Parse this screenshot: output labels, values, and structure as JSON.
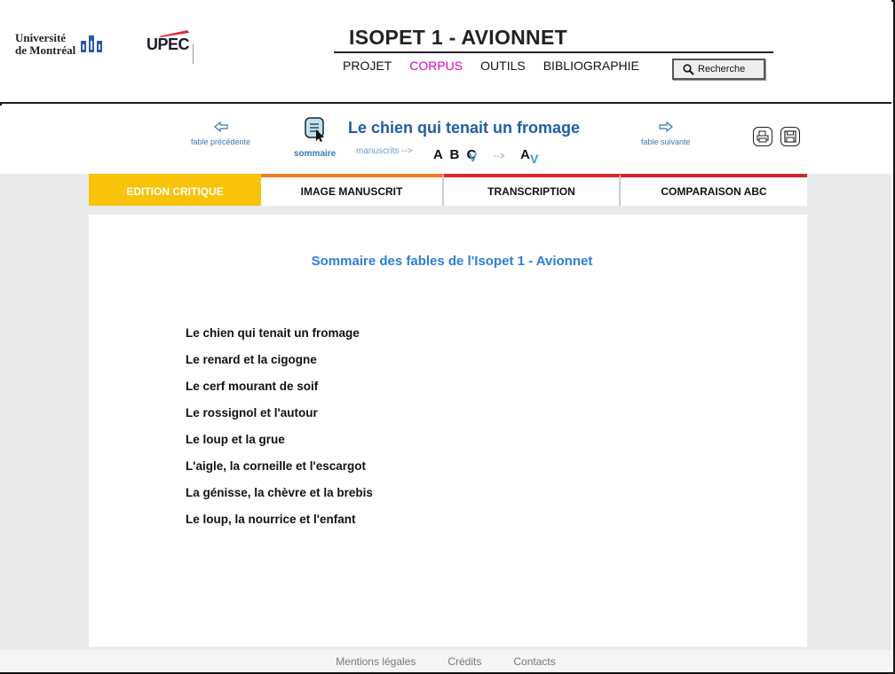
{
  "header": {
    "udem": {
      "line1": "Université",
      "line2": "de Montréal"
    },
    "upec": {
      "name": "UPEC"
    },
    "site_title": "ISOPET 1 - AVIONNET",
    "nav": [
      {
        "label": "PROJET"
      },
      {
        "label": "CORPUS",
        "active": true
      },
      {
        "label": "OUTILS"
      },
      {
        "label": "BIBLIOGRAPHIE"
      }
    ],
    "search_label": "Recherche"
  },
  "fable_nav": {
    "prev_label": "fable précédente",
    "next_label": "fable suivante",
    "sommaire_label": "sommaire",
    "title": "Le chien qui tenait un fromage",
    "manuscrits_label": "manuscrits -->",
    "manuscripts": "A B C",
    "arrow": "-->",
    "target": "A",
    "dropdown_glyph": "V"
  },
  "tabs": [
    {
      "label": "EDITION CRITIQUE",
      "active": true
    },
    {
      "label": "IMAGE MANUSCRIT"
    },
    {
      "label": "TRANSCRIPTION"
    },
    {
      "label": "COMPARAISON ABC"
    }
  ],
  "panel": {
    "title": "Sommaire des fables de l'Isopet 1 - Avionnet",
    "fables": [
      "Le chien qui tenait un fromage",
      "Le renard et la cigogne",
      "Le cerf mourant de soif",
      "Le rossignol et l'autour",
      "Le loup et la grue",
      "L'aigle, la corneille et l'escargot",
      "La génisse, la chèvre et la brebis",
      "Le loup, la nourrice et l'enfant"
    ]
  },
  "footer": {
    "links": [
      "Mentions légales",
      "Crédits",
      "Contacts"
    ]
  },
  "colors": {
    "accent_nav": "#e100c8",
    "title_blue": "#1f5fa3",
    "tab_yellow": "#f9c30c",
    "tab_orange": "#ef7c22",
    "tab_red": "#e0262c"
  }
}
